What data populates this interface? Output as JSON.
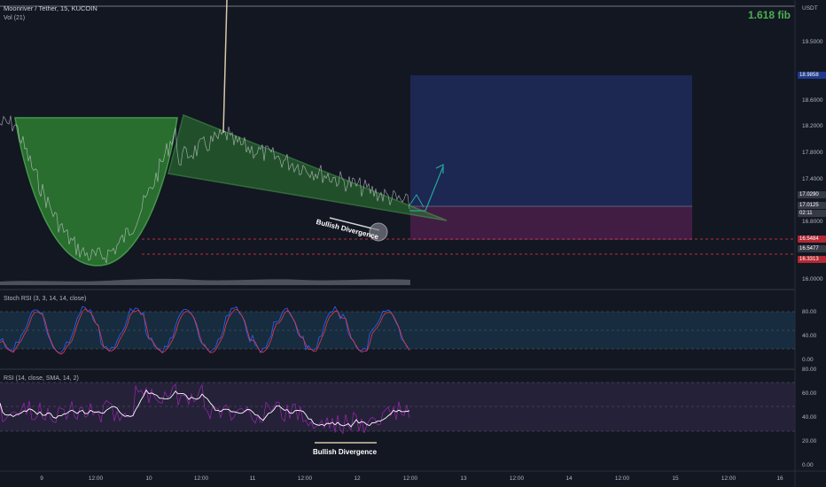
{
  "header": {
    "symbol_line": "Moonriver / Tether, 15, KUCOIN",
    "volume_label": "Vol (21)",
    "fib_label": "1.618 fib",
    "currency": "USDT"
  },
  "price_axis": {
    "ticks": [
      "19.5000",
      "18.6000",
      "18.2000",
      "17.8000",
      "17.4000",
      "16.8000",
      "16.0000"
    ],
    "tags": [
      {
        "text": "18.9858",
        "color": "#1e3a8a"
      },
      {
        "text": "17.0290",
        "color": "#363a45"
      },
      {
        "text": "17.0125",
        "color": "#363a45"
      },
      {
        "text": "02:11",
        "color": "#363a45"
      },
      {
        "text": "16.5484",
        "color": "#b22833"
      },
      {
        "text": "16.5477",
        "color": "#363a45"
      },
      {
        "text": "16.3313",
        "color": "#b22833"
      }
    ]
  },
  "stoch_panel": {
    "label": "Stoch RSI (3, 3, 14, 14, close)",
    "ticks": [
      "80.00",
      "40.00",
      "0.00"
    ]
  },
  "rsi_panel": {
    "label": "RSI (14, close, SMA, 14, 2)",
    "ticks": [
      "80.00",
      "60.00",
      "40.00",
      "20.00",
      "0.00"
    ]
  },
  "time_axis": {
    "labels": [
      "9",
      "12:00",
      "10",
      "12:00",
      "11",
      "12:00",
      "12",
      "12:00",
      "13",
      "12:00",
      "14",
      "12:00",
      "15",
      "12:00",
      "16"
    ]
  },
  "annotations": {
    "price_divergence": "Bullish Divergence",
    "rsi_divergence": "Bullish Divergence"
  },
  "colors": {
    "background": "#131722",
    "cup_fill": "#2e7d32",
    "pattern_line": "#4caf50",
    "target_zone": "#1e2a5a",
    "stop_zone": "#4a1f4a",
    "stoch_k": "#2962ff",
    "stoch_d": "#f23645",
    "rsi_line": "#ffffff"
  }
}
